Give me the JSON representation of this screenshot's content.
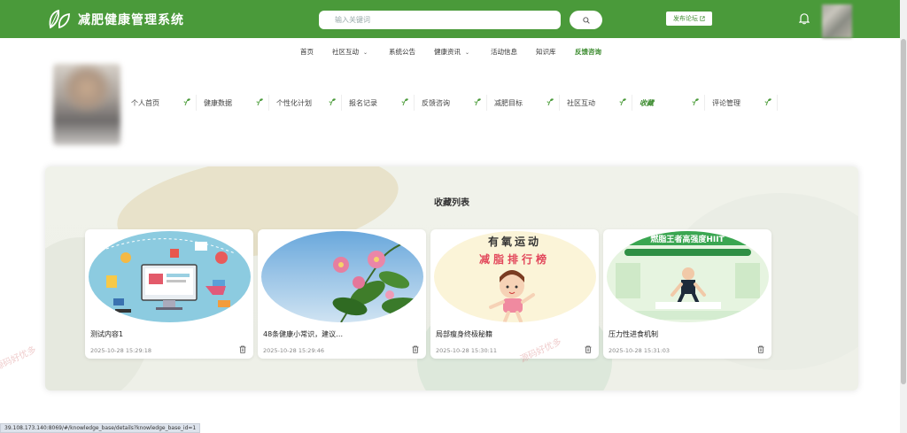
{
  "header": {
    "app_title": "减肥健康管理系统",
    "search_placeholder": "输入关键词",
    "publish_label": "发布论坛",
    "accent_color": "#4a9a3a"
  },
  "topnav": {
    "items": [
      {
        "label": "首页",
        "has_dropdown": false,
        "active": false
      },
      {
        "label": "社区互动",
        "has_dropdown": true,
        "active": false
      },
      {
        "label": "系统公告",
        "has_dropdown": false,
        "active": false
      },
      {
        "label": "健康资讯",
        "has_dropdown": true,
        "active": false
      },
      {
        "label": "活动信息",
        "has_dropdown": false,
        "active": false
      },
      {
        "label": "知识库",
        "has_dropdown": false,
        "active": false
      },
      {
        "label": "反馈咨询",
        "has_dropdown": false,
        "active": true
      }
    ]
  },
  "subnav": {
    "items": [
      {
        "label": "个人首页",
        "active": false
      },
      {
        "label": "健康数据",
        "active": false
      },
      {
        "label": "个性化计划",
        "active": false
      },
      {
        "label": "报名记录",
        "active": false
      },
      {
        "label": "反馈咨询",
        "active": false
      },
      {
        "label": "减肥目标",
        "active": false
      },
      {
        "label": "社区互动",
        "active": false
      },
      {
        "label": "收藏",
        "active": true
      },
      {
        "label": "评论管理",
        "active": false
      }
    ]
  },
  "favorites": {
    "title": "收藏列表",
    "cards": [
      {
        "title": "测试内容1",
        "date": "2025-10-28 15:29:18",
        "image": "computer-shopping-illustration"
      },
      {
        "title": "48条健康小常识，建议…",
        "date": "2025-10-28 15:29:46",
        "image": "pink-flowers-sky-photo"
      },
      {
        "title": "局部瘦身终极秘籍",
        "date": "2025-10-28 15:30:11",
        "image": "aerobic-exercise-ranking-poster",
        "image_text": [
          "有氧运动",
          "减脂排行榜"
        ]
      },
      {
        "title": "压力性进食机制",
        "date": "2025-10-28 15:31:03",
        "image": "hiit-workout-poster",
        "image_text": [
          "燃脂王者高强度HIIT"
        ]
      }
    ]
  },
  "watermark": "源码好优多",
  "status_bar": {
    "url": "39.108.173.140:8069/#/knowledge_base/details?knowledge_base_id=1"
  }
}
